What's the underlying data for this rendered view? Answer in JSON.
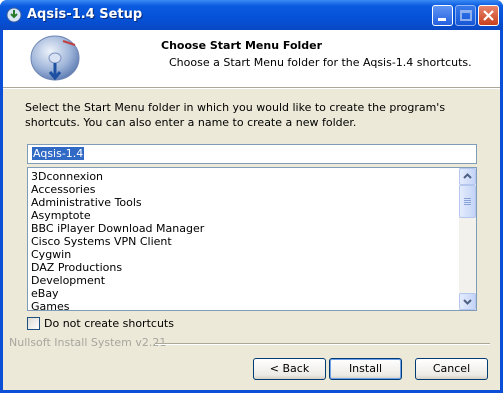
{
  "window": {
    "title": "Aqsis-1.4 Setup",
    "icon": "installer-icon",
    "controls": [
      "minimize-icon",
      "maximize-icon",
      "close-icon"
    ]
  },
  "header": {
    "title": "Choose Start Menu Folder",
    "subtitle": "Choose a Start Menu folder for the Aqsis-1.4 shortcuts."
  },
  "instructions": "Select the Start Menu folder in which you would like to create the program's shortcuts. You can also enter a name to create a new folder.",
  "folder_name": {
    "value": "Aqsis-1.4"
  },
  "folders": [
    "3Dconnexion",
    "Accessories",
    "Administrative Tools",
    "Asymptote",
    "BBC iPlayer Download Manager",
    "Cisco Systems VPN Client",
    "Cygwin",
    "DAZ Productions",
    "Development",
    "eBay",
    "Games"
  ],
  "no_shortcuts": {
    "label": "Do not create shortcuts",
    "checked": false
  },
  "branding": "Nullsoft Install System v2.21",
  "buttons": {
    "back": "< Back",
    "install": "Install",
    "cancel": "Cancel"
  },
  "colors": {
    "titlebar": "#0552d8",
    "dialog_bg": "#ece9d8",
    "selection": "#316ac5"
  }
}
